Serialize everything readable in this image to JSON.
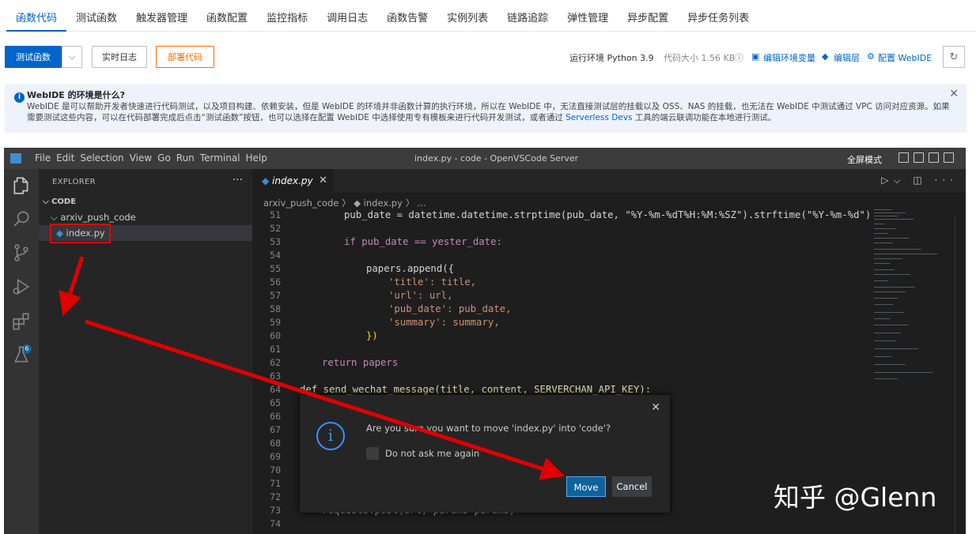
{
  "top_tabs": [
    "函数代码",
    "测试函数",
    "触发器管理",
    "函数配置",
    "监控指标",
    "调用日志",
    "函数告警",
    "实例列表",
    "链路追踪",
    "弹性管理",
    "异步配置",
    "异步任务列表"
  ],
  "toolbar": {
    "test_button": "测试函数",
    "caret": "⌵",
    "realtime_log": "实时日志",
    "deploy_code": "部署代码",
    "runtime": "运行环境 Python 3.9",
    "code_size": "代码大小 1.56 KB",
    "edit_env": "编辑环境变量",
    "edit_layer": "编辑层",
    "config_webide": "配置 WebIDE",
    "refresh_icon": "refresh-icon"
  },
  "notice": {
    "title": "WebIDE 的环境是什么?",
    "line1": "WebIDE 是可以帮助开发者快速进行代码测试，以及项目构建、依赖安装，但是 WebIDE 的环境并非函数计算的执行环境，所以在 WebIDE 中，无法直接测试层的挂载以及 OSS、NAS 的挂载，也无法在 WebIDE 中测试通过 VPC 访问对应资源。如果",
    "line2a": "需要测试这些内容，可以在代码部署完成后点击“测试函数”按钮，也可以选择在配置 WebIDE 中选择使用专有模板来进行代码开发测试，或者通过 ",
    "link": "Serverless Devs",
    "line2b": " 工具的端云联调功能在本地进行测试。"
  },
  "vscode": {
    "menu": [
      "File",
      "Edit",
      "Selection",
      "View",
      "Go",
      "Run",
      "Terminal",
      "Help"
    ],
    "window_title": "index.py - code - OpenVSCode Server",
    "fullscreen": "全屏模式",
    "badge_count": "6",
    "explorer_title": "EXPLORER",
    "explorer_dots": "···",
    "tree": {
      "root": "CODE",
      "folder": "arxiv_push_code",
      "file": "index.py"
    },
    "editor_tab": "index.py",
    "breadcrumb": "arxiv_push_code 〉 ◆ index.py 〉 ...",
    "code_lines": [
      {
        "n": "51",
        "text": ""
      },
      {
        "n": "52",
        "text": ""
      },
      {
        "n": "53",
        "text": ""
      },
      {
        "n": "54",
        "text": ""
      },
      {
        "n": "55",
        "text": ""
      },
      {
        "n": "56",
        "text": ""
      },
      {
        "n": "57",
        "text": ""
      },
      {
        "n": "58",
        "text": ""
      },
      {
        "n": "59",
        "text": ""
      },
      {
        "n": "60",
        "text": ""
      },
      {
        "n": "61",
        "text": ""
      },
      {
        "n": "62",
        "text": ""
      },
      {
        "n": "63",
        "text": ""
      },
      {
        "n": "64",
        "text": ""
      },
      {
        "n": "65",
        "text": ""
      },
      {
        "n": "66",
        "text": ""
      },
      {
        "n": "67",
        "text": ""
      },
      {
        "n": "68",
        "text": ""
      },
      {
        "n": "69",
        "text": ""
      },
      {
        "n": "70",
        "text": ""
      },
      {
        "n": "71",
        "text": ""
      },
      {
        "n": "72",
        "text": ""
      },
      {
        "n": "73",
        "text": ""
      },
      {
        "n": "74",
        "text": ""
      }
    ],
    "code": {
      "l51": "pub_date = datetime.datetime.strptime(pub_date, \"%Y-%m-%dT%H:%M:%SZ\").strftime(\"%Y-%m-%d\")",
      "l53": "if pub_date == yester_date:",
      "l55": "papers.append({",
      "l56": "'title': title,",
      "l57": "'url': url,",
      "l58": "'pub_date': pub_date,",
      "l59": "'summary': summary,",
      "l60": "})",
      "l62": "return papers",
      "l64": "def send_wechat_message(title, content, SERVERCHAN_API_KEY):",
      "l73": "requests.post(url, params=params)"
    },
    "dialog": {
      "message": "Are you sure you want to move 'index.py' into 'code'?",
      "checkbox_label": "Do not ask me again",
      "move": "Move",
      "cancel": "Cancel"
    }
  },
  "watermark": "知乎 @Glenn",
  "colors": {
    "accent": "#0064c8",
    "orange": "#ff6a00",
    "annotation_red": "#e00000"
  }
}
